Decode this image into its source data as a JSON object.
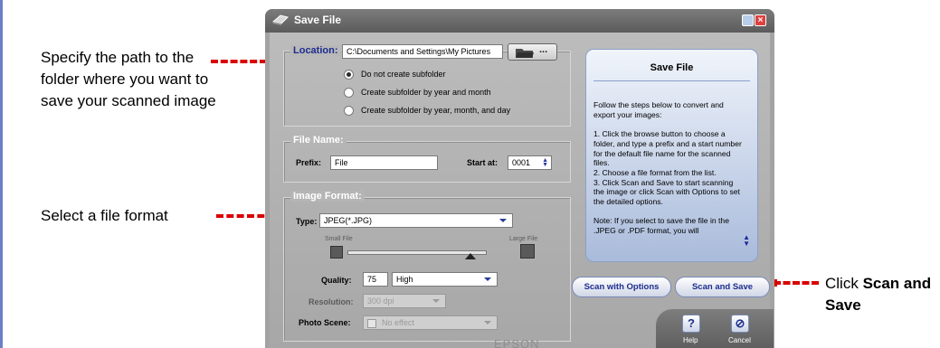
{
  "callouts": {
    "location": "Specify the path to the folder where you want to save your scanned image",
    "format": "Select a file format",
    "save_prefix": "Click ",
    "save_bold": "Scan and Save"
  },
  "window": {
    "title": "Save File",
    "location": {
      "label": "Location:",
      "path": "C:\\Documents and Settings\\My Pictures",
      "browse_label": "...",
      "options": [
        "Do not create subfolder",
        "Create subfolder by year and month",
        "Create subfolder by year, month, and day"
      ],
      "selected": 0
    },
    "file_name": {
      "label": "File Name:",
      "prefix_label": "Prefix:",
      "prefix_value": "File",
      "start_label": "Start at:",
      "start_value": "0001"
    },
    "image_format": {
      "label": "Image Format:",
      "type_label": "Type:",
      "type_value": "JPEG(*.JPG)",
      "small_file": "Small File",
      "large_file": "Large File",
      "size_level": 0.88,
      "quality_label": "Quality:",
      "quality_value": "75",
      "quality_preset": "High",
      "resolution_label": "Resolution:",
      "resolution_value": "300 dpi",
      "photo_scene_label": "Photo Scene:",
      "photo_scene_value": "No effect"
    },
    "help_panel": {
      "title": "Save File",
      "text": "Follow the steps below to convert and export your images:\n\n1. Click the browse button to choose a folder, and type a prefix and a start number for the default file name for the scanned files.\n2. Choose a file format from the list.\n3. Click Scan and Save to start scanning the image or click Scan with Options to set the detailed options.\n\nNote: If you select to save the file in the .JPEG or .PDF format, you will"
    },
    "buttons": {
      "scan_with_options": "Scan with Options",
      "scan_and_save": "Scan and Save",
      "help": "Help",
      "cancel": "Cancel",
      "help_glyph": "?",
      "cancel_glyph": "⊘"
    },
    "brand": "EPSON"
  },
  "colors": {
    "leader": "#d90000",
    "accent": "#1c2d8f",
    "page_bar": "#6b7fc9"
  }
}
